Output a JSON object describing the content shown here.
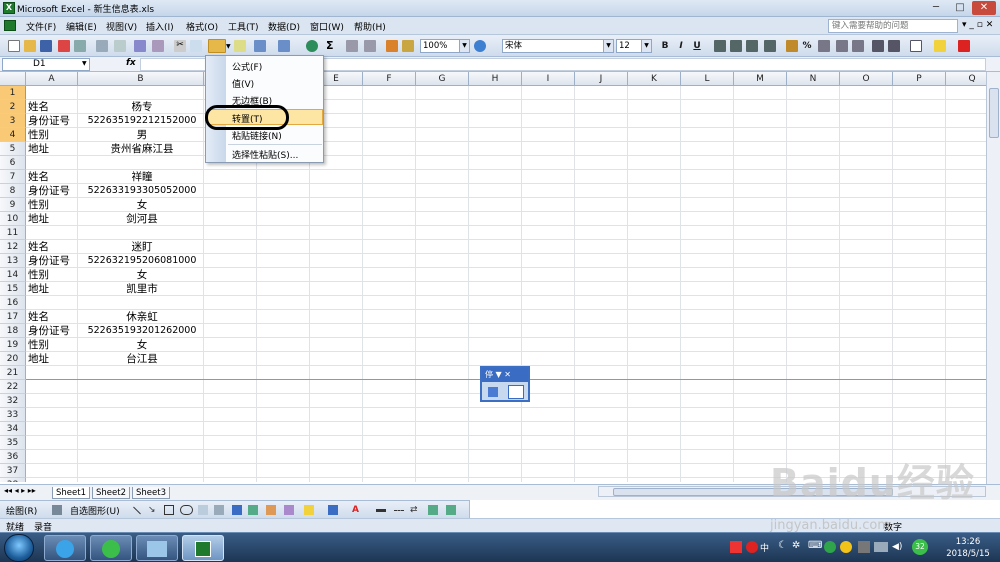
{
  "window": {
    "title": "Microsoft Excel - 新生信息表.xls",
    "app_icon_letter": "X"
  },
  "menu": {
    "items": [
      "文件(F)",
      "编辑(E)",
      "视图(V)",
      "插入(I)",
      "格式(O)",
      "工具(T)",
      "数据(D)",
      "窗口(W)",
      "帮助(H)"
    ],
    "help_placeholder": "键入需要帮助的问题"
  },
  "toolbar": {
    "zoom": "100%",
    "font_name": "宋体",
    "font_size": "12",
    "bold": "B",
    "italic": "I",
    "underline": "U",
    "percent": "%"
  },
  "formula_bar": {
    "name_box": "D1",
    "fx": "fx"
  },
  "columns": [
    "A",
    "B",
    "C",
    "D",
    "E",
    "F",
    "G",
    "H",
    "I",
    "J",
    "K",
    "L",
    "M",
    "N",
    "O",
    "P",
    "Q"
  ],
  "rows": [
    "1",
    "2",
    "3",
    "4",
    "5",
    "6",
    "7",
    "8",
    "9",
    "10",
    "11",
    "12",
    "13",
    "14",
    "15",
    "16",
    "17",
    "18",
    "19",
    "20",
    "21",
    "22",
    "32",
    "33",
    "34",
    "35",
    "36",
    "37",
    "38"
  ],
  "cells": [
    {
      "row": 2,
      "a": "姓名",
      "b": "杨专"
    },
    {
      "row": 3,
      "a": "身份证号",
      "b": "522635192212152000"
    },
    {
      "row": 4,
      "a": "性别",
      "b": "男"
    },
    {
      "row": 5,
      "a": "地址",
      "b": "贵州省麻江县"
    },
    {
      "row": 7,
      "a": "姓名",
      "b": "祥瞳"
    },
    {
      "row": 8,
      "a": "身份证号",
      "b": "522633193305052000"
    },
    {
      "row": 9,
      "a": "性别",
      "b": "女"
    },
    {
      "row": 10,
      "a": "地址",
      "b": "剑河县"
    },
    {
      "row": 12,
      "a": "姓名",
      "b": "迷盯"
    },
    {
      "row": 13,
      "a": "身份证号",
      "b": "522632195206081000"
    },
    {
      "row": 14,
      "a": "性别",
      "b": "女"
    },
    {
      "row": 15,
      "a": "地址",
      "b": "凯里市"
    },
    {
      "row": 17,
      "a": "姓名",
      "b": "休亲虹"
    },
    {
      "row": 18,
      "a": "身份证号",
      "b": "522635193201262000"
    },
    {
      "row": 19,
      "a": "性别",
      "b": "女"
    },
    {
      "row": 20,
      "a": "地址",
      "b": "台江县"
    }
  ],
  "paste_menu": {
    "items": [
      "公式(F)",
      "值(V)",
      "无边框(B)",
      "转置(T)",
      "粘贴链接(N)",
      "选择性粘贴(S)..."
    ],
    "highlighted": "转置(T)"
  },
  "paste_float": {
    "label": "停"
  },
  "sheets": [
    "Sheet1",
    "Sheet2",
    "Sheet3"
  ],
  "drawing": {
    "draw_label": "绘图(R)",
    "autoshape_label": "自选图形(U)"
  },
  "status": {
    "left": "就绪",
    "mode": "录音",
    "right": "数字"
  },
  "taskbar": {
    "time": "13:26",
    "date": "2018/5/15",
    "tray_text": "中",
    "badge": "32"
  },
  "watermark": {
    "logo": "Baidu经验",
    "url": "jingyan.baidu.com"
  },
  "colors": {
    "accent": "#3b6cc4",
    "selected_row": "#f9c976",
    "menu_highlight": "#fde6a4"
  }
}
